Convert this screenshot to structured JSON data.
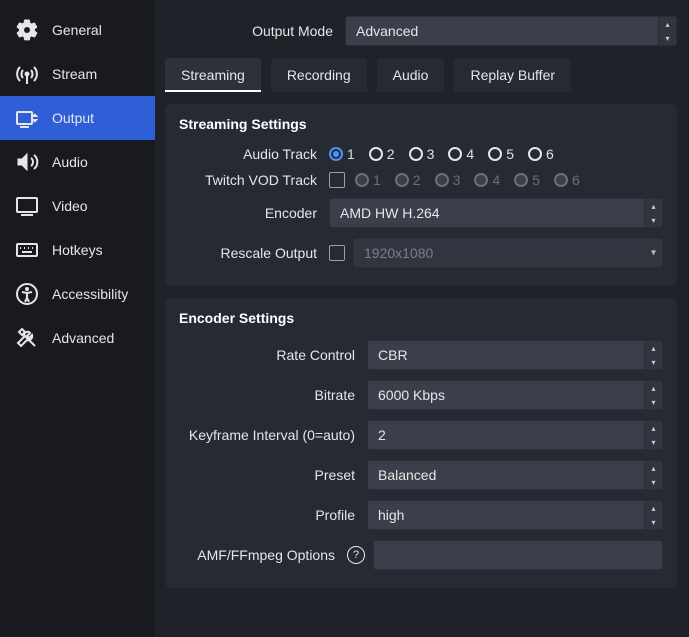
{
  "sidebar": {
    "items": [
      {
        "label": "General"
      },
      {
        "label": "Stream"
      },
      {
        "label": "Output"
      },
      {
        "label": "Audio"
      },
      {
        "label": "Video"
      },
      {
        "label": "Hotkeys"
      },
      {
        "label": "Accessibility"
      },
      {
        "label": "Advanced"
      }
    ]
  },
  "outputMode": {
    "label": "Output Mode",
    "value": "Advanced"
  },
  "tabs": [
    {
      "label": "Streaming"
    },
    {
      "label": "Recording"
    },
    {
      "label": "Audio"
    },
    {
      "label": "Replay Buffer"
    }
  ],
  "streaming": {
    "title": "Streaming Settings",
    "audio_track_label": "Audio Track",
    "twitch_vod_label": "Twitch VOD Track",
    "tracks": [
      "1",
      "2",
      "3",
      "4",
      "5",
      "6"
    ],
    "encoder_label": "Encoder",
    "encoder_value": "AMD HW H.264",
    "rescale_label": "Rescale Output",
    "rescale_placeholder": "1920x1080"
  },
  "encoder": {
    "title": "Encoder Settings",
    "rate_control_label": "Rate Control",
    "rate_control_value": "CBR",
    "bitrate_label": "Bitrate",
    "bitrate_value": "6000 Kbps",
    "keyframe_label": "Keyframe Interval (0=auto)",
    "keyframe_value": "2",
    "preset_label": "Preset",
    "preset_value": "Balanced",
    "profile_label": "Profile",
    "profile_value": "high",
    "amf_label": "AMF/FFmpeg Options"
  }
}
